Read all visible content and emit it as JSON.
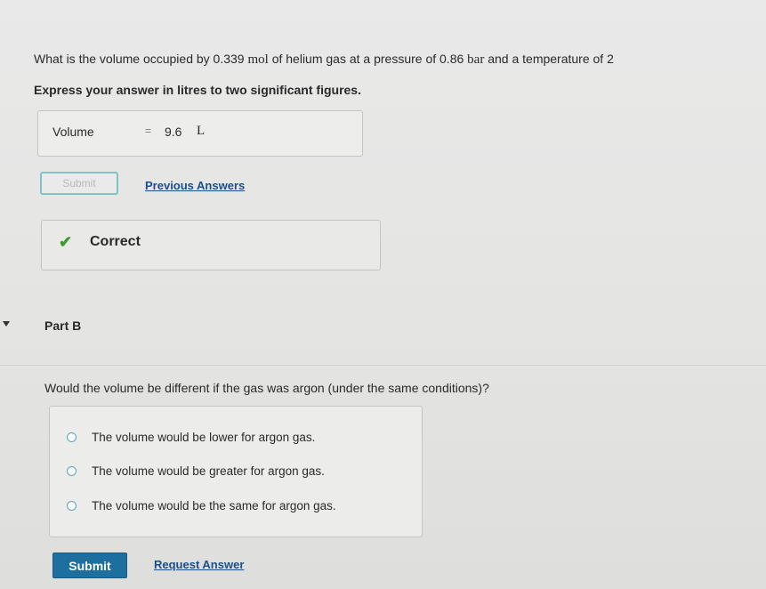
{
  "part_a": {
    "question_prefix": "What is the volume occupied by 0.339 ",
    "unit_mol": "mol",
    "question_middle": " of helium gas at a pressure of 0.86 ",
    "unit_bar": "bar",
    "question_suffix": " and a temperature of 2",
    "instruction": "Express your answer in litres to two significant figures.",
    "answer_label": "Volume",
    "answer_equals": "=",
    "answer_value": "9.6",
    "answer_unit": "L",
    "submit_label": "Submit",
    "previous_answers_label": "Previous Answers",
    "feedback_icon": "check-icon",
    "feedback_text": "Correct"
  },
  "part_b": {
    "title": "Part B",
    "question": "Would the volume be different if the gas was argon (under the same conditions)?",
    "options": [
      "The volume would be lower for argon gas.",
      "The volume would be greater for argon gas.",
      "The volume would be the same for argon gas."
    ],
    "submit_label": "Submit",
    "request_answer_label": "Request Answer"
  },
  "colors": {
    "link": "#1b4f8c",
    "submit_button": "#1d6fa0",
    "correct_check": "#3d9a2f",
    "radio_border": "#5aa7b8"
  }
}
